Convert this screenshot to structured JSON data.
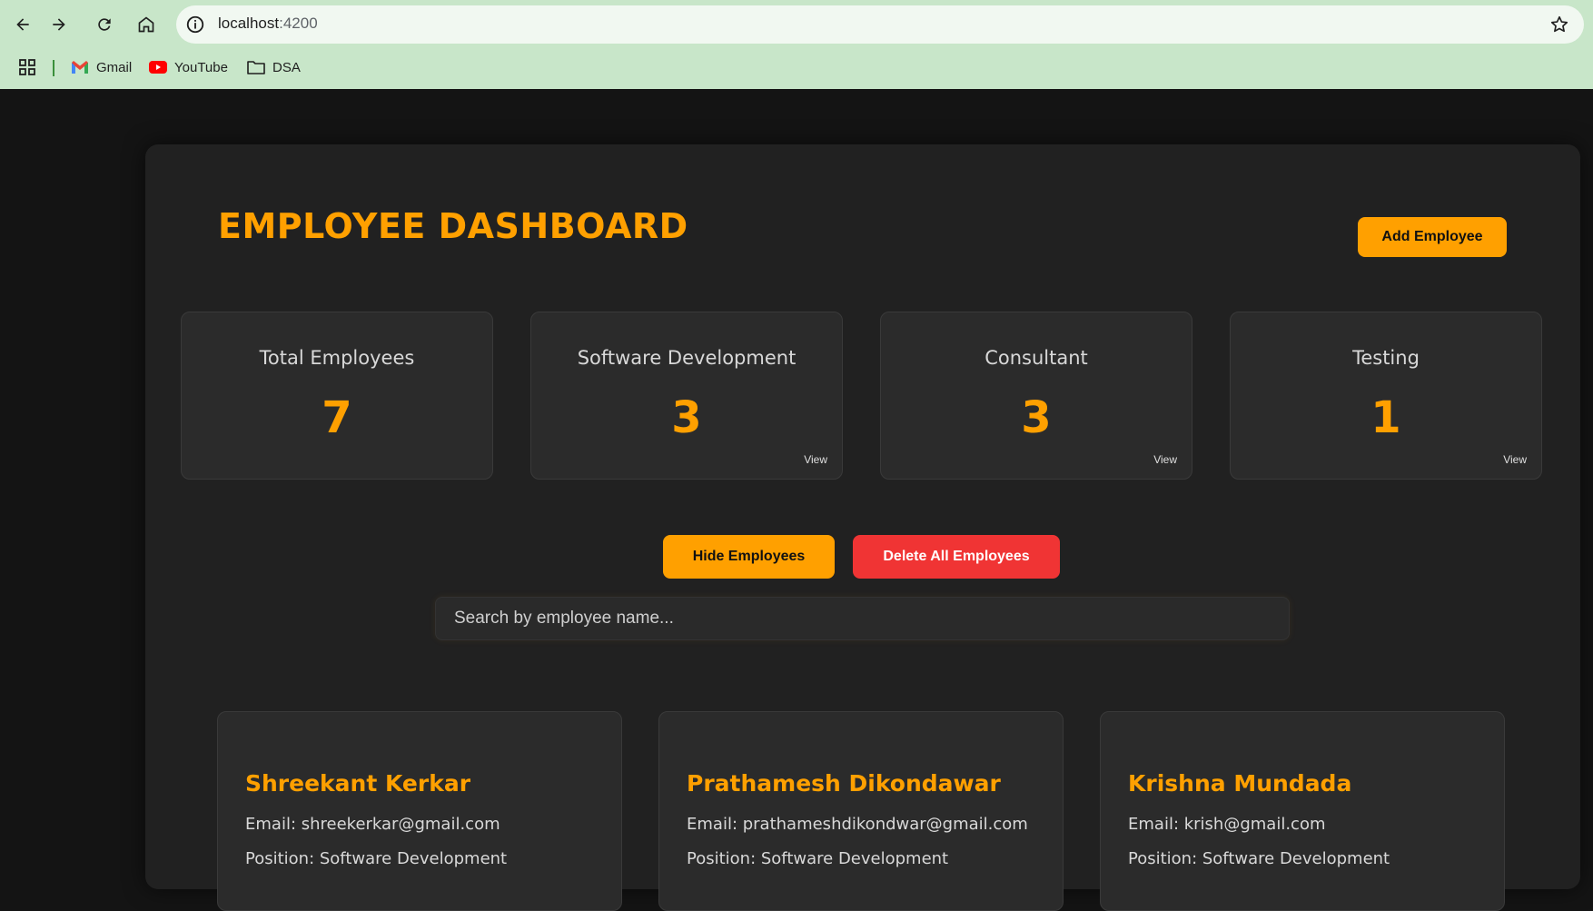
{
  "browser": {
    "url_host": "localhost",
    "url_port": ":4200",
    "bookmarks": [
      {
        "label": "Gmail"
      },
      {
        "label": "YouTube"
      },
      {
        "label": "DSA"
      }
    ]
  },
  "dashboard": {
    "title": "EMPLOYEE DASHBOARD",
    "add_button": "Add Employee",
    "stats": [
      {
        "label": "Total Employees",
        "value": "7",
        "view": ""
      },
      {
        "label": "Software Development",
        "value": "3",
        "view": "View"
      },
      {
        "label": "Consultant",
        "value": "3",
        "view": "View"
      },
      {
        "label": "Testing",
        "value": "1",
        "view": "View"
      }
    ],
    "hide_button": "Hide Employees",
    "delete_button": "Delete All Employees",
    "search_placeholder": "Search by employee name...",
    "employees": [
      {
        "name": "Shreekant Kerkar",
        "email": "Email: shreekerkar@gmail.com",
        "position": "Position: Software Development"
      },
      {
        "name": "Prathamesh Dikondawar",
        "email": "Email: prathameshdikondwar@gmail.com",
        "position": "Position: Software Development"
      },
      {
        "name": "Krishna Mundada",
        "email": "Email: krish@gmail.com",
        "position": "Position: Software Development"
      }
    ]
  },
  "colors": {
    "accent": "#ffa000",
    "danger": "#f03434",
    "background": "#141414",
    "panel": "#212121",
    "card": "#2b2b2b",
    "chrome": "#c8e6c9"
  }
}
